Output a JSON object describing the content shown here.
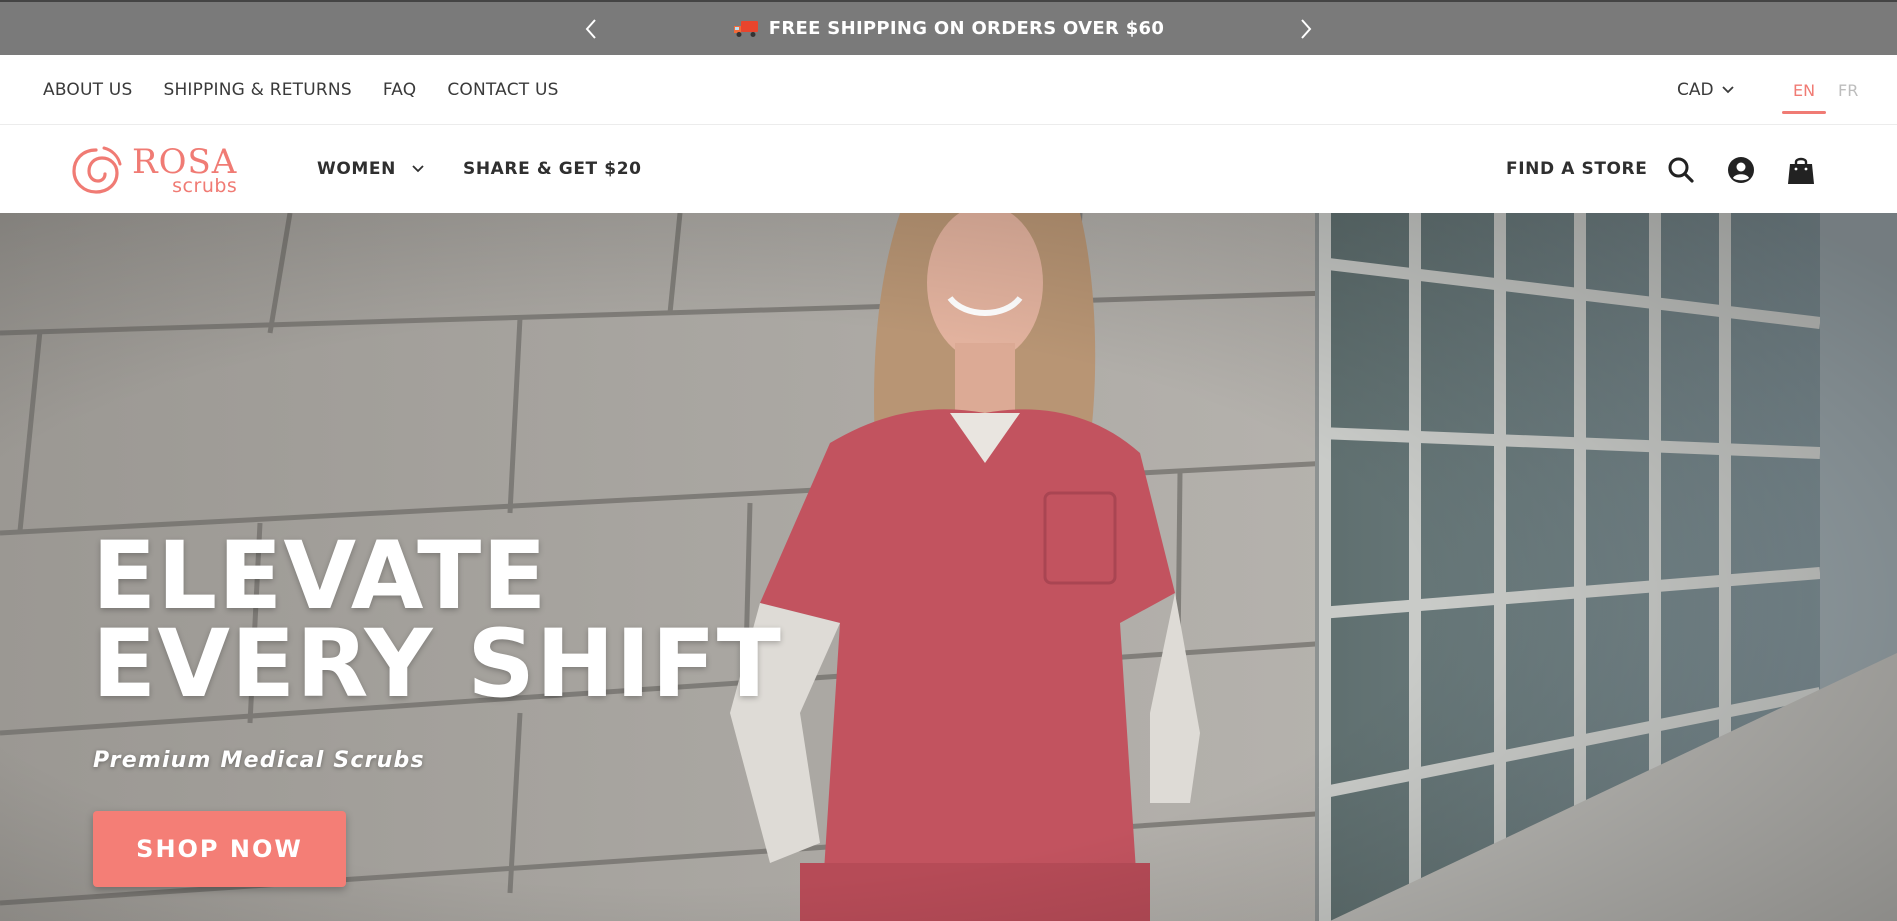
{
  "announcement": {
    "text": "FREE SHIPPING ON ORDERS OVER $60",
    "icon": "truck-icon"
  },
  "utility": {
    "links": [
      "ABOUT US",
      "SHIPPING & RETURNS",
      "FAQ",
      "CONTACT US"
    ],
    "currency": "CAD",
    "languages": {
      "active": "EN",
      "other": "FR"
    }
  },
  "brand": {
    "name": "ROSA",
    "tagline": "scrubs",
    "color": "#f07b74"
  },
  "nav": {
    "women": "WOMEN",
    "share": "SHARE & GET $20",
    "find_store": "FIND A STORE"
  },
  "hero": {
    "headline_line1": "ELEVATE",
    "headline_line2": "EVERY SHIFT",
    "subheadline": "Premium Medical Scrubs",
    "cta": "SHOP NOW",
    "cta_color": "#f47e76"
  }
}
